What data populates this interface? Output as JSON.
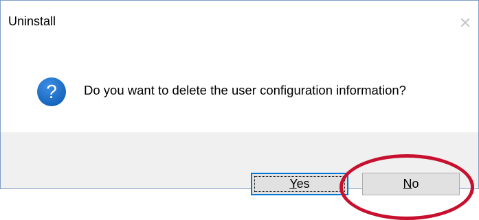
{
  "window": {
    "title": "Uninstall",
    "close_glyph": "✕"
  },
  "message": {
    "icon": "question-icon",
    "icon_color": "#1a6fc9",
    "text": "Do you want to delete the user configuration information?"
  },
  "buttons": {
    "yes": {
      "accelerator": "Y",
      "rest": "es",
      "is_default": true
    },
    "no": {
      "accelerator": "N",
      "rest": "o",
      "is_default": false
    }
  },
  "annotation": {
    "shape": "ellipse",
    "color": "#c8102e",
    "target": "no-button"
  }
}
